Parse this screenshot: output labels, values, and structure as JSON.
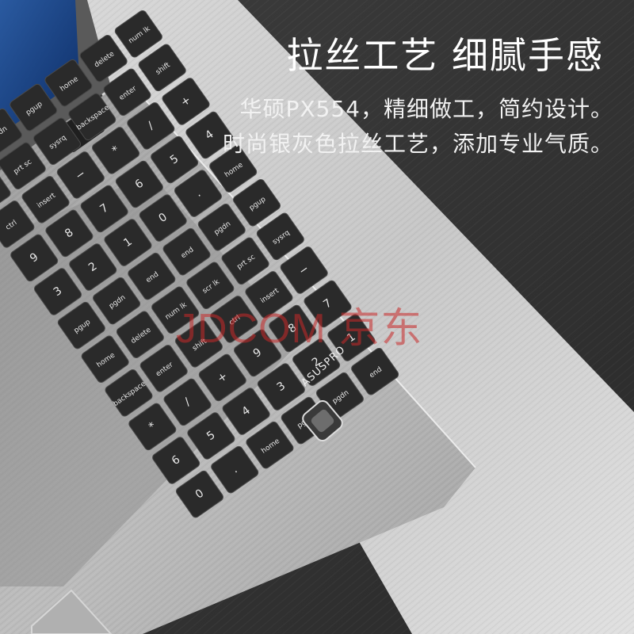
{
  "headline": "拉丝工艺 细腻手感",
  "subtitle_line1": "华硕PX554，精细做工，简约设计。",
  "subtitle_line2": "时尚银灰色拉丝工艺，添加专业气质。",
  "watermark": "JDCOM 京东",
  "brand_mark": "ASUSPRO",
  "colors": {
    "background_dark": "#2c2c2c",
    "chassis_silver": "#b8b8b8",
    "key_black": "#2a2a2a",
    "watermark_red": "#c82828"
  },
  "keyboard": {
    "rows": [
      [
        "end",
        "",
        "pgdn",
        "",
        "pgup",
        "",
        "home",
        "",
        "delete"
      ],
      [
        "−",
        "*",
        "/",
        "num lk",
        "",
        "prt sc",
        "backspace"
      ],
      [
        "+",
        "9",
        "8",
        "7",
        "",
        "\\"
      ],
      [
        "6",
        "5",
        "4",
        "",
        "enter",
        "]"
      ],
      [
        "enter",
        "3",
        "2",
        "1",
        "",
        "shift"
      ],
      [
        "delete",
        "0",
        "",
        "",
        "ctrl"
      ]
    ],
    "labels": [
      "end",
      "pgdn",
      "pgup",
      "home",
      "delete",
      "num lk",
      "scr lk",
      "prt sc",
      "sysrq",
      "backspace",
      "enter",
      "shift",
      "ctrl",
      "insert",
      "−",
      "*",
      "/",
      "+",
      "9",
      "8",
      "7",
      "6",
      "5",
      "4",
      "3",
      "2",
      "1",
      "0",
      ".",
      "home",
      "pgup",
      "pgdn",
      "end"
    ]
  }
}
